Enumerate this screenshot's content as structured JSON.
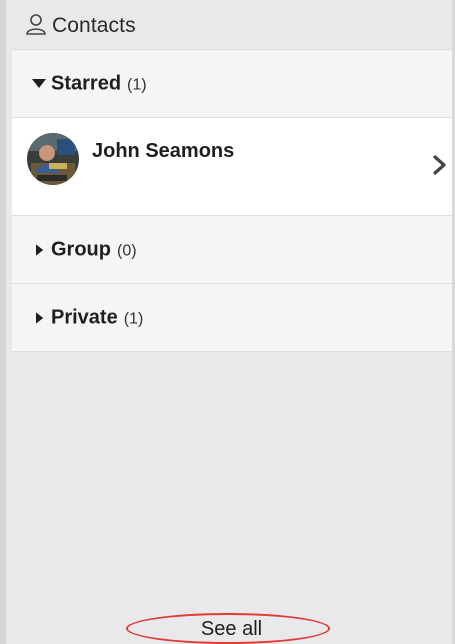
{
  "header": {
    "title": "Contacts",
    "icon": "person-icon"
  },
  "groups": [
    {
      "label": "Starred",
      "count": "(1)",
      "expanded": true
    },
    {
      "label": "Group",
      "count": "(0)",
      "expanded": false
    },
    {
      "label": "Private",
      "count": "(1)",
      "expanded": false
    }
  ],
  "starred_contacts": [
    {
      "name": "John Seamons",
      "avatar": "avatar-photo",
      "action_icon": "chevron-right-icon"
    }
  ],
  "footer": {
    "see_all_label": "See all",
    "highlight_color": "#e53935"
  }
}
